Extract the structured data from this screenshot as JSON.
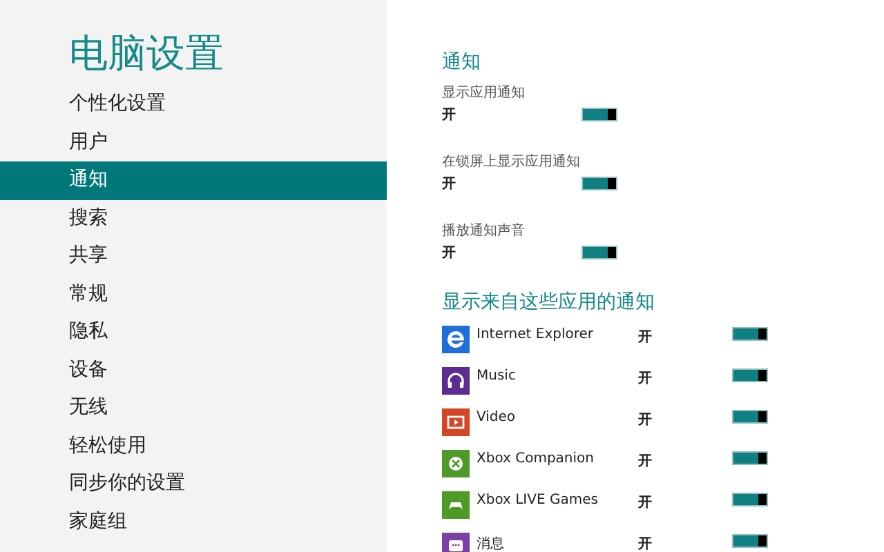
{
  "sidebar": {
    "title": "电脑设置",
    "items": [
      {
        "label": "个性化设置",
        "selected": false
      },
      {
        "label": "用户",
        "selected": false
      },
      {
        "label": "通知",
        "selected": true
      },
      {
        "label": "搜索",
        "selected": false
      },
      {
        "label": "共享",
        "selected": false
      },
      {
        "label": "常规",
        "selected": false
      },
      {
        "label": "隐私",
        "selected": false
      },
      {
        "label": "设备",
        "selected": false
      },
      {
        "label": "无线",
        "selected": false
      },
      {
        "label": "轻松使用",
        "selected": false
      },
      {
        "label": "同步你的设置",
        "selected": false
      },
      {
        "label": "家庭组",
        "selected": false
      }
    ]
  },
  "content": {
    "heading": "通知",
    "settings": [
      {
        "label": "显示应用通知",
        "state": "开",
        "on": true
      },
      {
        "label": "在锁屏上显示应用通知",
        "state": "开",
        "on": true
      },
      {
        "label": "播放通知声音",
        "state": "开",
        "on": true
      }
    ],
    "apps_heading": "显示来自这些应用的通知",
    "apps": [
      {
        "kind": "browser",
        "color": "#1e6fd9",
        "name": "Internet Explorer",
        "state": "开",
        "on": true
      },
      {
        "kind": "music",
        "color": "#5b2d90",
        "name": "Music",
        "state": "开",
        "on": true
      },
      {
        "kind": "video",
        "color": "#d24726",
        "name": "Video",
        "state": "开",
        "on": true
      },
      {
        "kind": "xbox",
        "color": "#4e9a28",
        "name": "Xbox Companion",
        "state": "开",
        "on": true
      },
      {
        "kind": "games",
        "color": "#4e9a28",
        "name": "Xbox LIVE Games",
        "state": "开",
        "on": true
      },
      {
        "kind": "messaging",
        "color": "#7b3fa6",
        "name": "消息",
        "state": "开",
        "on": true
      }
    ]
  }
}
